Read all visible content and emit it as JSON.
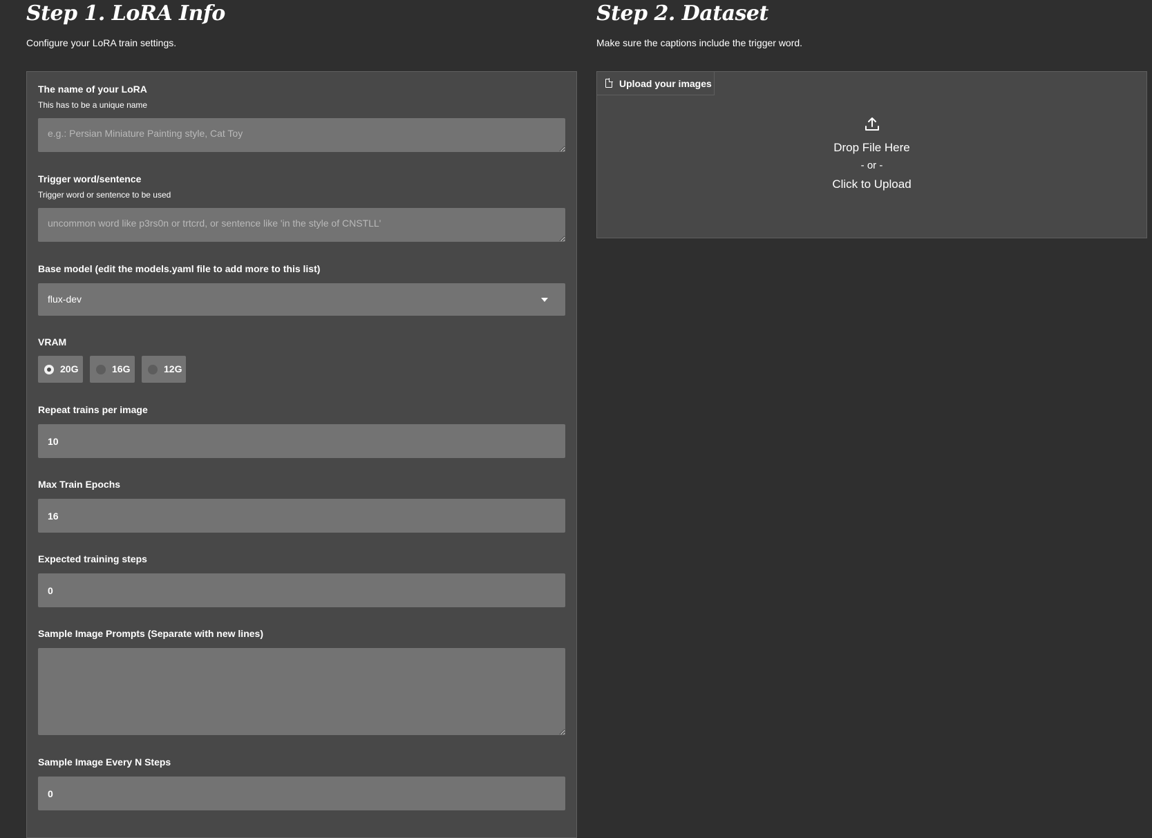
{
  "step1": {
    "title": "Step 1. LoRA Info",
    "description": "Configure your LoRA train settings.",
    "lora_name": {
      "label": "The name of your LoRA",
      "info": "This has to be a unique name",
      "placeholder": "e.g.: Persian Miniature Painting style, Cat Toy",
      "value": ""
    },
    "trigger": {
      "label": "Trigger word/sentence",
      "info": "Trigger word or sentence to be used",
      "placeholder": "uncommon word like p3rs0n or trtcrd, or sentence like 'in the style of CNSTLL'",
      "value": ""
    },
    "base_model": {
      "label": "Base model (edit the models.yaml file to add more to this list)",
      "selected": "flux-dev"
    },
    "vram": {
      "label": "VRAM",
      "options": [
        "20G",
        "16G",
        "12G"
      ],
      "selected": "20G"
    },
    "repeats": {
      "label": "Repeat trains per image",
      "value": "10"
    },
    "max_epochs": {
      "label": "Max Train Epochs",
      "value": "16"
    },
    "expected_steps": {
      "label": "Expected training steps",
      "value": "0"
    },
    "sample_prompts": {
      "label": "Sample Image Prompts (Separate with new lines)",
      "value": ""
    },
    "sample_every": {
      "label": "Sample Image Every N Steps",
      "value": "0"
    }
  },
  "step2": {
    "title": "Step 2. Dataset",
    "description": "Make sure the captions include the trigger word.",
    "upload": {
      "tab_label": "Upload your images",
      "icon": "upload-icon",
      "drop_text": "Drop File Here",
      "or_text": "- or -",
      "click_text": "Click to Upload"
    }
  },
  "colors": {
    "background": "#2f2f2f",
    "panel": "#484848",
    "input": "#737373",
    "border": "#5f5f5f"
  }
}
